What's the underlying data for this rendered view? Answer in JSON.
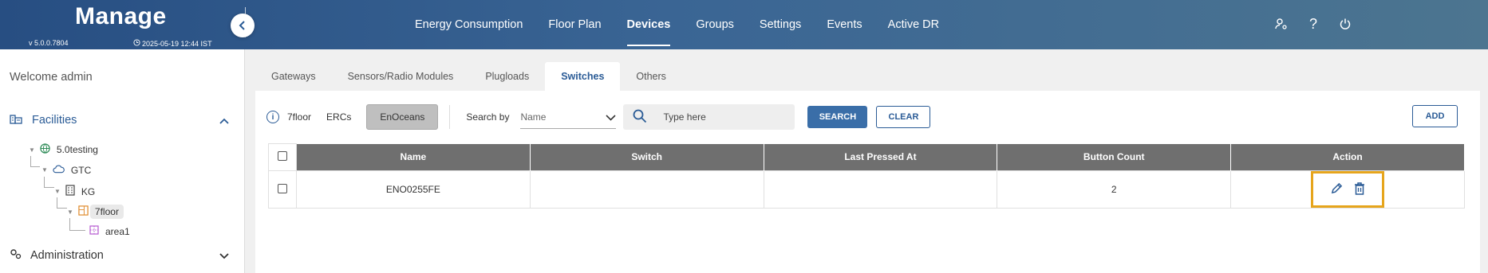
{
  "header": {
    "title": "Manage",
    "version": "v 5.0.0.7804",
    "datetime": "2025-05-19 12:44 IST",
    "nav": [
      "Energy Consumption",
      "Floor Plan",
      "Devices",
      "Groups",
      "Settings",
      "Events",
      "Active DR"
    ],
    "active_nav": "Devices",
    "icons": [
      "user-settings-icon",
      "help-icon",
      "power-icon"
    ]
  },
  "sidebar": {
    "welcome": "Welcome admin",
    "facilities_label": "Facilities",
    "administration_label": "Administration",
    "tree": {
      "site": "5.0testing",
      "cloud": "GTC",
      "building": "KG",
      "floor": "7floor",
      "area": "area1"
    }
  },
  "tabs": [
    "Gateways",
    "Sensors/Radio Modules",
    "Plugloads",
    "Switches",
    "Others"
  ],
  "active_tab": "Switches",
  "filters": {
    "floor": "7floor",
    "ercs": "ERCs",
    "enoceans": "EnOceans",
    "search_by_label": "Search by",
    "search_by_value": "Name",
    "search_placeholder": "Type here",
    "search_button": "SEARCH",
    "clear_button": "CLEAR",
    "add_button": "ADD"
  },
  "table": {
    "columns": [
      "Name",
      "Switch",
      "Last Pressed At",
      "Button Count",
      "Action"
    ],
    "rows": [
      {
        "name": "ENO0255FE",
        "switch": "",
        "last_pressed": "",
        "button_count": "2"
      }
    ]
  },
  "colors": {
    "header_start": "#274e82",
    "accent": "#2a5b96",
    "highlight": "#e6a51c"
  }
}
